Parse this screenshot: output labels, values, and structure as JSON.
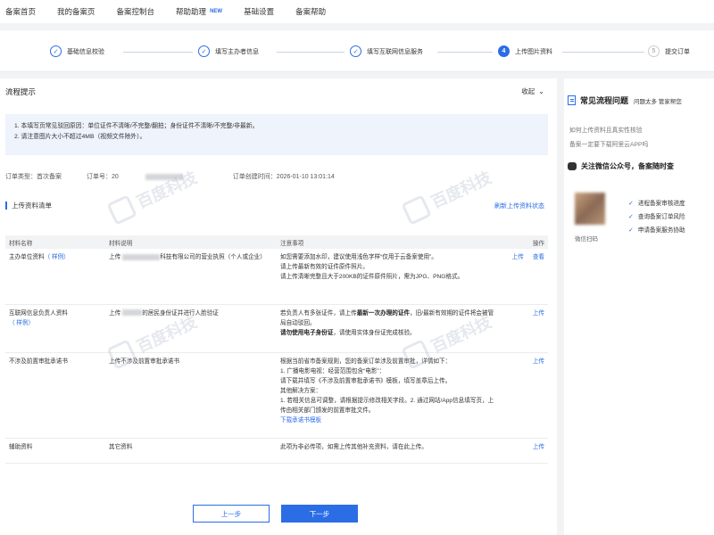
{
  "nav": {
    "items": [
      "备案首页",
      "我的备案页",
      "备案控制台",
      "帮助助理",
      "基础设置",
      "备案帮助"
    ],
    "badge": "NEW"
  },
  "steps": [
    {
      "num": "✓",
      "label": "基础信息校验"
    },
    {
      "num": "✓",
      "label": "填写主办者信息"
    },
    {
      "num": "✓",
      "label": "填写互联网信息服务"
    },
    {
      "num": "4",
      "label": "上传图片资料"
    },
    {
      "num": "5",
      "label": "提交订单"
    }
  ],
  "process": {
    "title": "流程提示",
    "collapse": "收起",
    "hints": [
      "1. 本填写页常见驳回原因：单位证件不清晰/不完整/翻拍；身份证件不清晰/不完整/非最新。",
      "2. 请注意图片大小不超过4MB（视频文件除外）。"
    ]
  },
  "order": {
    "type_label": "订单类型：首次备案",
    "no_label": "订单号：20",
    "created_label": "订单创建时间：2026-01-10 13:01:14"
  },
  "list": {
    "title": "上传资料清单",
    "refresh": "刷新上传资料状态",
    "headers": [
      "材料名称",
      "材料说明",
      "注意事项",
      "操作"
    ],
    "rows": [
      {
        "name": "主办单位资料",
        "example": "（ 样例）",
        "desc_a": "上传",
        "desc_b": "科技有限公司的营业执照（个人或企业）",
        "notes": [
          "如您需要添加水印，建议使用浅色字样“仅用于云备案使用”。",
          "请上传最新有效的证件原件照片。",
          "请上传清晰完整且大于200KB的证件原件照片，需为JPG、PNG格式。"
        ],
        "ops": [
          "上传",
          "查看"
        ]
      },
      {
        "name": "互联网信息负责人资料",
        "example": "（ 样例）",
        "desc_a": "上传",
        "desc_b": "的居民身份证并进行人脸验证",
        "note_a": "若负责人有多张证件，请上传",
        "note_bold": "最新一次办理的证件",
        "note_b": "，旧/最新有效期的证件将会被管局自动驳回。",
        "note_c_bold": "请勿使用电子身份证",
        "note_c": "，请使用实体身份证完成核验。",
        "ops": [
          "上传"
        ]
      },
      {
        "name": "不涉及前置审批承诺书",
        "desc": "上传不涉及前置审批承诺书",
        "notes": [
          "根据当前省市备案规则，您的备案订单涉及前置审批，详情如下：",
          "1. 广播电影电视：经营范围包含“电影”：",
          "请下载并填写《不涉及前置审批承诺书》模板，填写盖章后上传。",
          "其他解决方案：",
          "1. 若相关信息可调整，请根据提示修改相关字段。2. 通过网站/App信息填写页，上传由相关部门颁发的前置审批文件。"
        ],
        "download": "下载承诺书模板",
        "ops": [
          "上传"
        ]
      },
      {
        "name": "辅助资料",
        "desc": "其它资料",
        "notes": [
          "此项为非必传项，如需上传其他补充资料，请在此上传。"
        ],
        "ops": [
          "上传"
        ]
      }
    ]
  },
  "buttons": {
    "prev": "上一步",
    "next": "下一步"
  },
  "side": {
    "title": "常见流程问题",
    "subtitle": "问题太多 管家帮您",
    "links": [
      "如何上传资料且真实性核验",
      "备案一定要下载阿里云APP吗"
    ],
    "wechat_title": "关注微信公众号，备案随时查",
    "qr_caption": "微信扫码",
    "checks": [
      "进程备案审核进度",
      "查询备案订单风险",
      "申请备案服务协助"
    ]
  },
  "watermark": {
    "text": "百度科技"
  }
}
